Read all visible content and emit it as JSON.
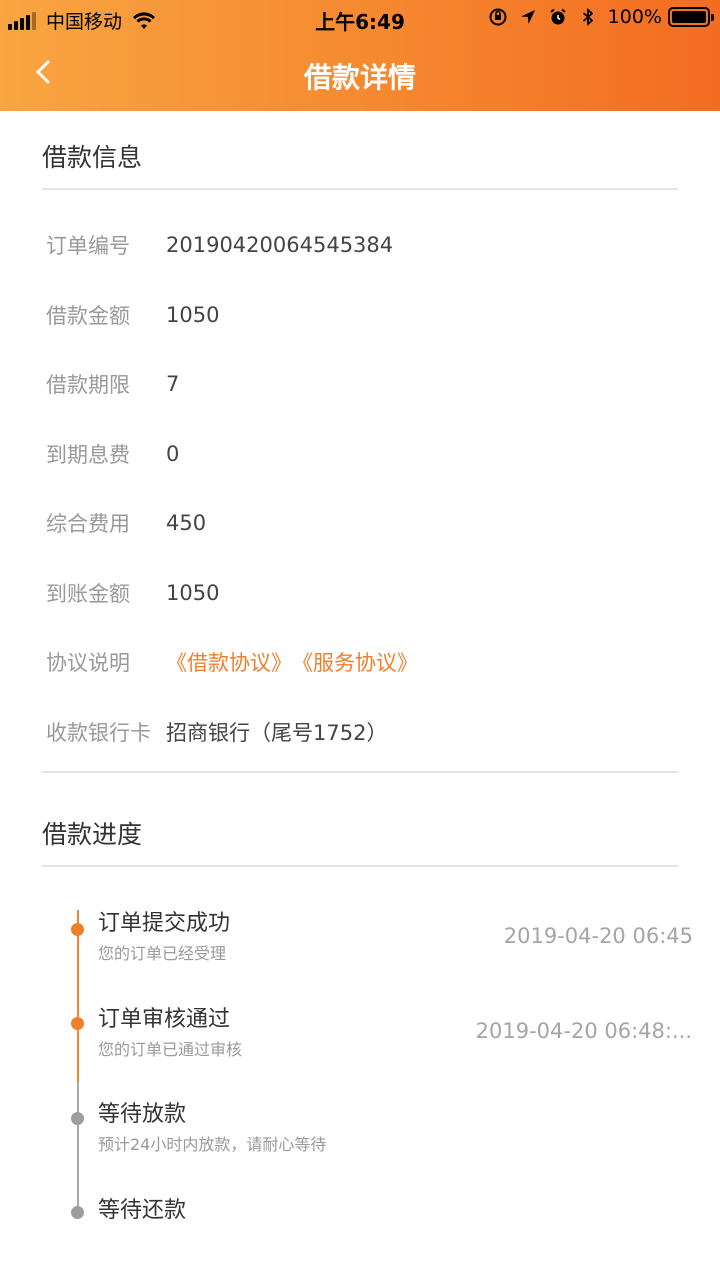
{
  "status_bar": {
    "carrier": "中国移动",
    "time": "上午6:49",
    "battery": "100%"
  },
  "nav": {
    "title": "借款详情",
    "back_icon": "chevron-left-icon"
  },
  "loan_info": {
    "section_title": "借款信息",
    "rows": [
      {
        "label": "订单编号",
        "value": "20190420064545384"
      },
      {
        "label": "借款金额",
        "value": "1050"
      },
      {
        "label": "借款期限",
        "value": "7"
      },
      {
        "label": "到期息费",
        "value": "0"
      },
      {
        "label": "综合费用",
        "value": "450"
      },
      {
        "label": "到账金额",
        "value": "1050"
      }
    ],
    "agreement": {
      "label": "协议说明",
      "links": [
        "《借款协议》",
        "《服务协议》"
      ]
    },
    "bank": {
      "label": "收款银行卡",
      "value": "招商银行（尾号1752）"
    }
  },
  "progress": {
    "section_title": "借款进度",
    "steps": [
      {
        "title": "订单提交成功",
        "sub": "您的订单已经受理",
        "time": "2019-04-20 06:45",
        "status": "done"
      },
      {
        "title": "订单审核通过",
        "sub": "您的订单已通过审核",
        "time": "2019-04-20 06:48:...",
        "status": "done"
      },
      {
        "title": "等待放款",
        "sub": "预计24小时内放款，请耐心等待",
        "time": "",
        "status": "wait"
      },
      {
        "title": "等待还款",
        "sub": "",
        "time": "",
        "status": "wait"
      }
    ]
  },
  "colors": {
    "accent": "#f07f2c",
    "header_start": "#f8a542",
    "header_end": "#f36c21",
    "label_gray": "#999999",
    "pending_gray": "#9d9d9d"
  }
}
